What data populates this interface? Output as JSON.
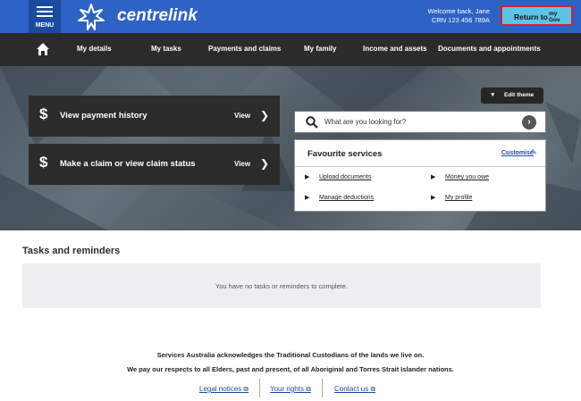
{
  "header": {
    "menu_label": "MENU",
    "logo_text": "centrelink",
    "welcome": "Welcome back, Jane",
    "crn": "CRN 123 456 789A",
    "return_label": "Return to",
    "mygov_line1": "my",
    "mygov_line2": "Gov",
    "colors": {
      "primary": "#2f62c5",
      "menu_bg": "#1c4a9f",
      "mygov": "#5dc4e8",
      "mygov_border": "#d2222f"
    }
  },
  "nav": {
    "home_icon": "home-icon",
    "items": [
      "My details",
      "My tasks",
      "Payments and claims",
      "My family",
      "Income and assets",
      "Documents and appointments"
    ]
  },
  "hero": {
    "cards": [
      {
        "icon": "dollar-icon",
        "title": "View payment history",
        "view": "View"
      },
      {
        "icon": "dollar-icon",
        "title": "Make a claim or view claim status",
        "view": "View"
      }
    ],
    "edit_theme": "Edit theme",
    "search": {
      "placeholder": "What are you looking for?"
    },
    "favourites": {
      "title": "Favourite services",
      "customise": "Customise",
      "links": [
        "Upload documents",
        "Money you owe",
        "Manage deductions",
        "My profile"
      ]
    }
  },
  "tasks": {
    "heading": "Tasks and reminders",
    "empty": "You have no tasks or reminders to complete."
  },
  "footer": {
    "ack1": "Services Australia acknowledges the Traditional Custodians of the lands we live on.",
    "ack2": "We pay our respects to all Elders, past and present, of all Aboriginal and Torres Strait Islander nations.",
    "links": [
      "Legal notices",
      "Your rights",
      "Contact us"
    ]
  }
}
